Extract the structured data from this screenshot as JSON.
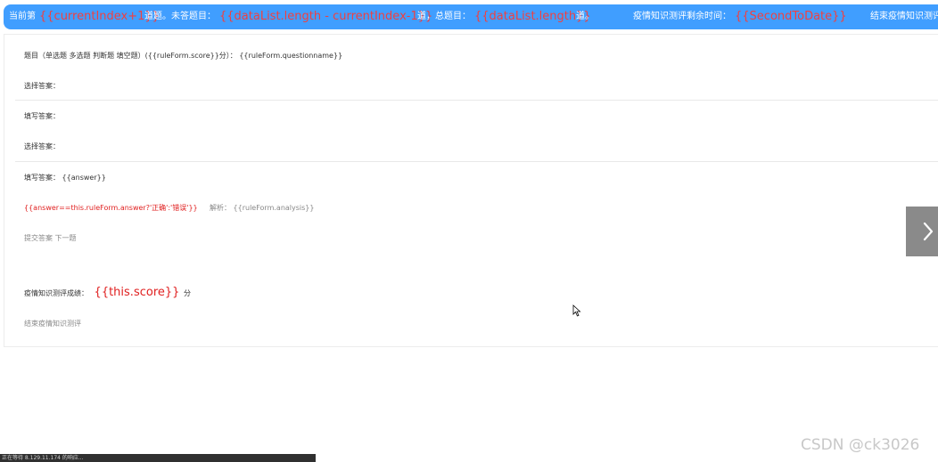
{
  "header": {
    "current_prefix": "当前第",
    "current_expr": "{{currentIndex+1}}",
    "current_suffix": "道题。未答题目：",
    "remaining_expr": "{{dataList.length - currentIndex-1}}",
    "remaining_suffix": "道，总题目：",
    "total_expr": "{{dataList.length}}",
    "total_suffix": "道。",
    "timer_label": "疫情知识测评剩余时间：",
    "timer_expr": "{{SecondToDate}}",
    "end_button": "结束疫情知识测评"
  },
  "question": {
    "title_line": "题目（单选题 多选题 判断题 填空题）({{ruleForm.score}}分）：  {{ruleForm.questionname}}",
    "choose_answer_1": "选择答案：",
    "fill_answer_1": "填写答案：",
    "choose_answer_2": "选择答案：",
    "fill_answer_2": "填写答案：  {{answer}}",
    "result_expr": "{{answer==this.ruleForm.answer?'正确':'错误'}}",
    "analysis": "解析：  {{ruleForm.analysis}}",
    "submit_next": "提交答案 下一题"
  },
  "result": {
    "score_label": "疫情知识测评成绩：",
    "score_expr": "{{this.score}}",
    "score_unit": "分",
    "end_link": "结束疫情知识测评"
  },
  "nav": {
    "next_icon": "chevron-right-icon"
  },
  "status_bar": {
    "text": "正在等待 8.129.11.174 的响应..."
  },
  "watermark": "CSDN @ck3026",
  "colors": {
    "header_bg": "#409eff",
    "expr_red": "#f04040",
    "next_bg": "#8a8a8a"
  }
}
